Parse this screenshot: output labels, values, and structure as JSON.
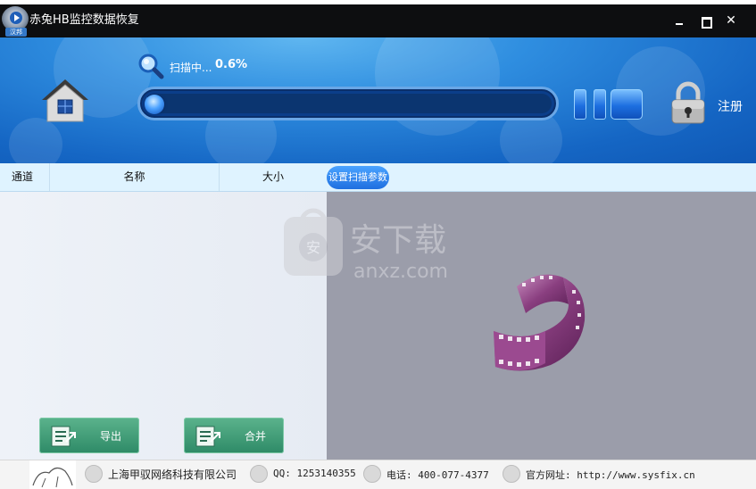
{
  "window": {
    "title": "赤兔HB监控数据恢复",
    "logo_tag": "汉邦"
  },
  "header": {
    "scan_label": "扫描中...",
    "scan_percent": "0.6%",
    "progress_fraction": 0.006,
    "register_label": "注册"
  },
  "columns": {
    "channel": "通道",
    "name": "名称",
    "size": "大小",
    "settings_button": "设置扫描参数"
  },
  "actions": {
    "export_label": "导出",
    "merge_label": "合并"
  },
  "watermark": {
    "text": "安下载",
    "sub": "anxz.com"
  },
  "footer": {
    "company": "上海甲驭网络科技有限公司",
    "qq": "QQ: 1253140355",
    "phone": "电话: 400-077-4377",
    "website": "官方网址: http://www.sysfix.cn"
  },
  "colors": {
    "header_blue": "#1566c4",
    "button_green": "#2e8a67",
    "preview_gray": "#9b9daa"
  }
}
